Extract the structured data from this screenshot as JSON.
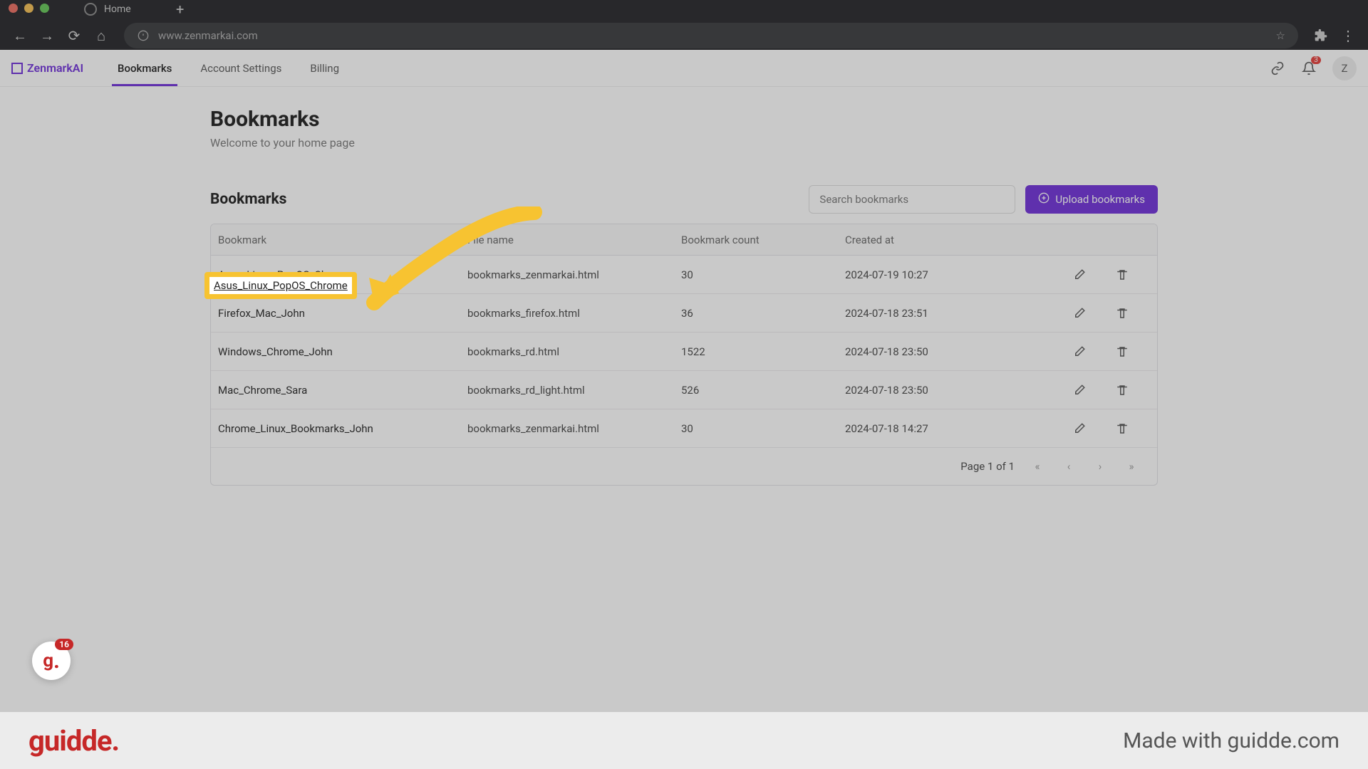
{
  "browser": {
    "tab_title": "Home",
    "url": "www.zenmarkai.com"
  },
  "brand": "ZenmarkAI",
  "nav": {
    "bookmarks": "Bookmarks",
    "account": "Account Settings",
    "billing": "Billing"
  },
  "notifications_count": "3",
  "avatar_letter": "Z",
  "page": {
    "title": "Bookmarks",
    "subtitle": "Welcome to your home page"
  },
  "section": {
    "title": "Bookmarks",
    "search_placeholder": "Search bookmarks",
    "upload_label": "Upload bookmarks"
  },
  "columns": {
    "bookmark": "Bookmark",
    "filename": "File name",
    "count": "Bookmark count",
    "created": "Created at"
  },
  "rows": [
    {
      "name": "Asus_Linux_PopOS_Chrome",
      "file": "bookmarks_zenmarkai.html",
      "count": "30",
      "created": "2024-07-19 10:27"
    },
    {
      "name": "Firefox_Mac_John",
      "file": "bookmarks_firefox.html",
      "count": "36",
      "created": "2024-07-18 23:51"
    },
    {
      "name": "Windows_Chrome_John",
      "file": "bookmarks_rd.html",
      "count": "1522",
      "created": "2024-07-18 23:50"
    },
    {
      "name": "Mac_Chrome_Sara",
      "file": "bookmarks_rd_light.html",
      "count": "526",
      "created": "2024-07-18 23:50"
    },
    {
      "name": "Chrome_Linux_Bookmarks_John",
      "file": "bookmarks_zenmarkai.html",
      "count": "30",
      "created": "2024-07-18 14:27"
    }
  ],
  "pager": {
    "label": "Page 1 of 1"
  },
  "float_badge_count": "16",
  "footer": {
    "brand": "guidde.",
    "made": "Made with guidde.com"
  },
  "highlight_text": "Asus_Linux_PopOS_Chrome"
}
